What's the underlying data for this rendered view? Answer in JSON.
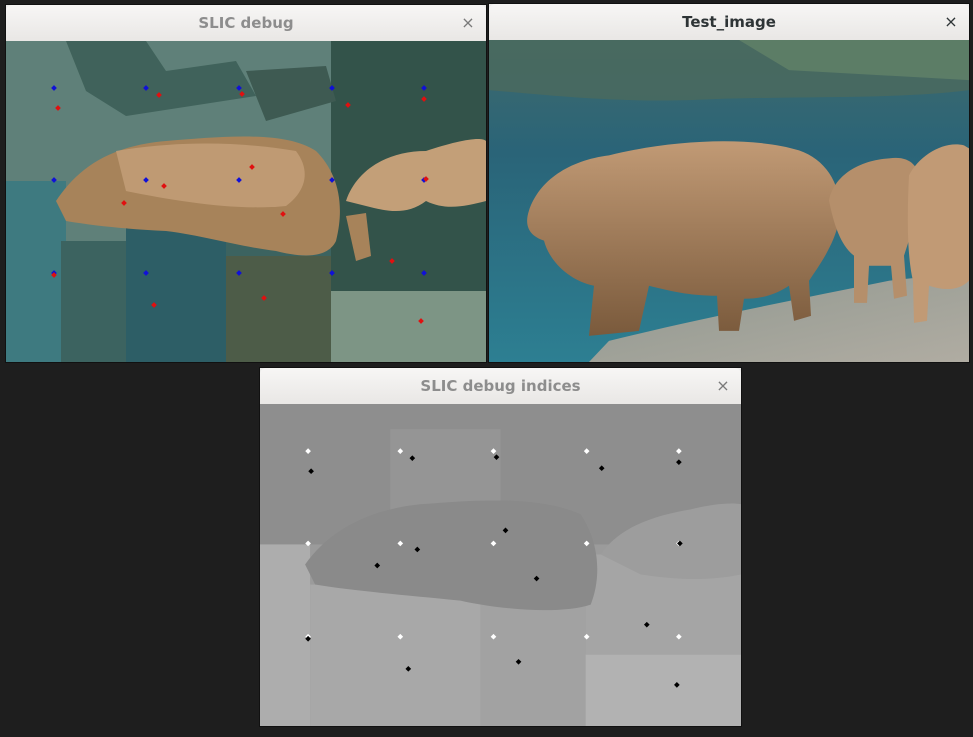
{
  "windows": [
    {
      "id": "slic-debug",
      "title": "SLIC debug",
      "close_glyph": "×",
      "active": false
    },
    {
      "id": "test-image",
      "title": "Test_image",
      "close_glyph": "×",
      "active": true
    },
    {
      "id": "slic-debug-indices",
      "title": "SLIC debug indices",
      "close_glyph": "×",
      "active": false
    }
  ],
  "icons": {
    "close": "close-icon"
  },
  "colors": {
    "desktop": "#1e1e1e",
    "grid_marker": "#1010d8",
    "center_marker": "#e01010",
    "indices_grid_marker": "#ffffff",
    "indices_center_marker": "#000000"
  }
}
